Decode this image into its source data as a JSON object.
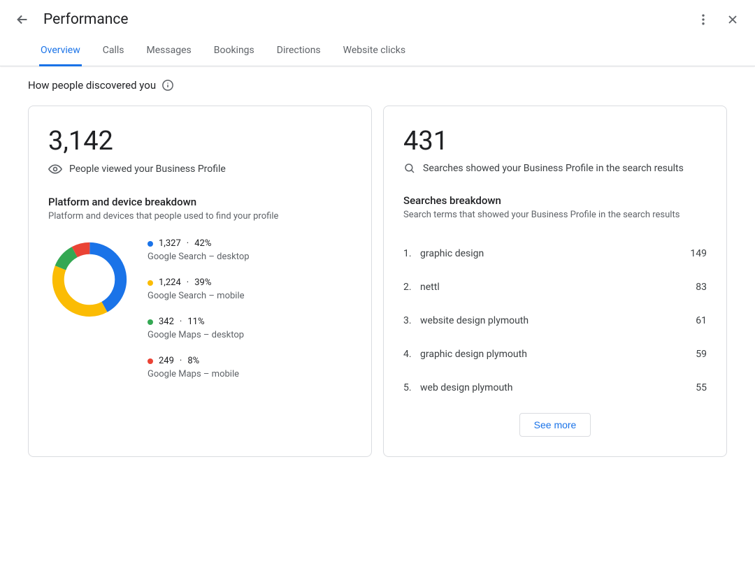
{
  "header": {
    "title": "Performance"
  },
  "tabs": [
    {
      "label": "Overview",
      "active": true
    },
    {
      "label": "Calls",
      "active": false
    },
    {
      "label": "Messages",
      "active": false
    },
    {
      "label": "Bookings",
      "active": false
    },
    {
      "label": "Directions",
      "active": false
    },
    {
      "label": "Website clicks",
      "active": false
    }
  ],
  "section_title": "How people discovered you",
  "views_card": {
    "total": "3,142",
    "subtitle": "People viewed your Business Profile",
    "breakdown_title": "Platform and device breakdown",
    "breakdown_desc": "Platform and devices that people used to find your profile",
    "items": [
      {
        "count": "1,327",
        "pct": "42%",
        "label": "Google Search – desktop",
        "color": "#1a73e8"
      },
      {
        "count": "1,224",
        "pct": "39%",
        "label": "Google Search – mobile",
        "color": "#fbbc04"
      },
      {
        "count": "342",
        "pct": "11%",
        "label": "Google Maps – desktop",
        "color": "#34a853"
      },
      {
        "count": "249",
        "pct": "8%",
        "label": "Google Maps – mobile",
        "color": "#ea4335"
      }
    ]
  },
  "searches_card": {
    "total": "431",
    "subtitle": "Searches showed your Business Profile in the search results",
    "breakdown_title": "Searches breakdown",
    "breakdown_desc": "Search terms that showed your Business Profile in the search results",
    "items": [
      {
        "idx": "1.",
        "term": "graphic design",
        "count": "149"
      },
      {
        "idx": "2.",
        "term": "nettl",
        "count": "83"
      },
      {
        "idx": "3.",
        "term": "website design plymouth",
        "count": "61"
      },
      {
        "idx": "4.",
        "term": "graphic design plymouth",
        "count": "59"
      },
      {
        "idx": "5.",
        "term": "web design plymouth",
        "count": "55"
      }
    ],
    "see_more": "See more"
  },
  "chart_data": {
    "type": "pie",
    "title": "Platform and device breakdown",
    "series": [
      {
        "name": "Google Search – desktop",
        "value": 1327,
        "pct": 42,
        "color": "#1a73e8"
      },
      {
        "name": "Google Search – mobile",
        "value": 1224,
        "pct": 39,
        "color": "#fbbc04"
      },
      {
        "name": "Google Maps – desktop",
        "value": 342,
        "pct": 11,
        "color": "#34a853"
      },
      {
        "name": "Google Maps – mobile",
        "value": 249,
        "pct": 8,
        "color": "#ea4335"
      }
    ]
  }
}
